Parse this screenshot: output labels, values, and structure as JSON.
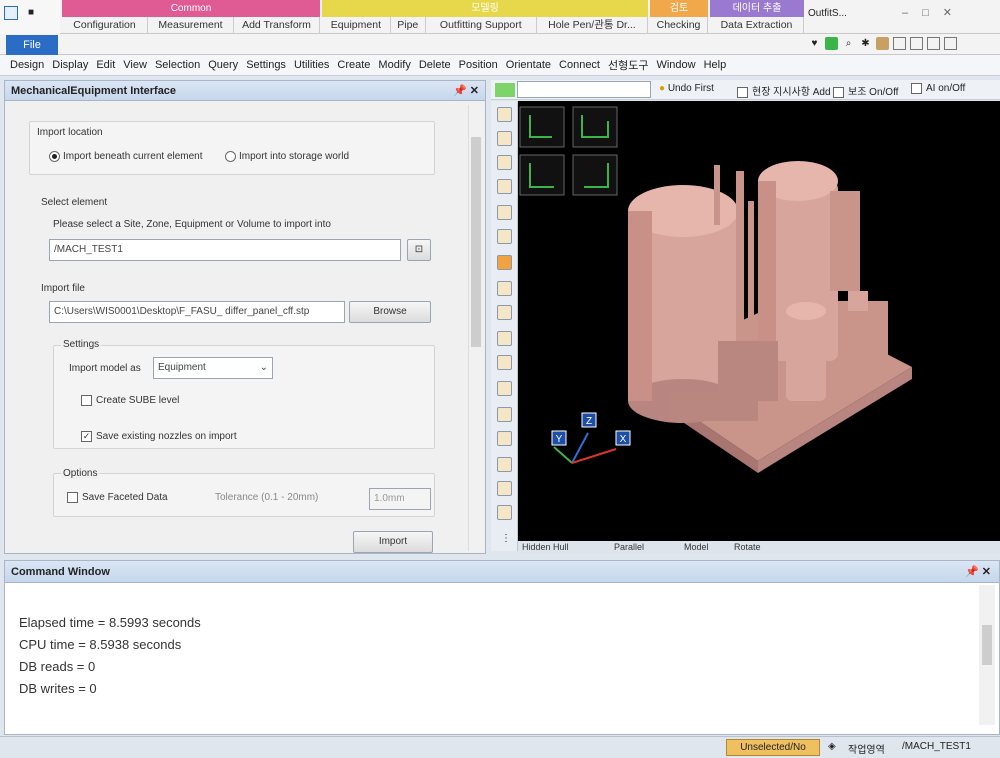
{
  "ribbon": {
    "groups": [
      {
        "title": "Common",
        "color": "#e05a94",
        "tabs": [
          "Configuration",
          "Measurement",
          "Add Transform"
        ]
      },
      {
        "title": "모델링",
        "color": "#e6d84a",
        "tabs": [
          "Equipment",
          "Pipe",
          "Outfitting Support",
          "Hole Pen/관통 Dr..."
        ]
      },
      {
        "title": "검토",
        "color": "#f0a84a",
        "tabs": [
          "Checking"
        ]
      },
      {
        "title": "데이터 추출",
        "color": "#9a7ad0",
        "tabs": [
          "Data Extraction"
        ]
      }
    ],
    "extra_tab": "OutfitS...",
    "file_tab": "File"
  },
  "menu": [
    "Design",
    "Display",
    "Edit",
    "View",
    "Selection",
    "Query",
    "Settings",
    "Utilities",
    "Create",
    "Modify",
    "Delete",
    "Position",
    "Orientate",
    "Connect",
    "선형도구",
    "Window",
    "Help"
  ],
  "left_panel": {
    "title": "MechanicalEquipment Interface",
    "import_location_label": "Import location",
    "radio_beneath": "Import beneath current element",
    "radio_storage": "Import into storage world",
    "select_element_label": "Select element",
    "select_element_hint": "Please select a Site, Zone, Equipment or Volume to import into",
    "element_value": "/MACH_TEST1",
    "import_file_label": "Import file",
    "file_path": "C:\\Users\\WIS0001\\Desktop\\F_FASU_ differ_panel_cff.stp",
    "browse_label": "Browse",
    "settings_label": "Settings",
    "import_model_as_label": "Import model as",
    "import_model_as_value": "Equipment",
    "create_subee_label": "Create SUBE level",
    "save_nozzles_label": "Save existing nozzles on import",
    "options_label": "Options",
    "save_faceted_label": "Save Faceted Data",
    "tolerance_label": "Tolerance (0.1 - 20mm)",
    "tolerance_value": "1.0mm",
    "import_button": "Import"
  },
  "view": {
    "undo_first": "Undo First",
    "check1": "현장 지시사항 Add",
    "check2": "보조 On/Off",
    "check3": "AI on/Off",
    "status": [
      "Hidden Hull",
      "Parallel",
      "Model",
      "Rotate"
    ],
    "axes": [
      "Y",
      "Z",
      "X"
    ]
  },
  "command": {
    "title": "Command Window",
    "lines": [
      "Elapsed time  = 8.5993 seconds",
      "CPU time       = 8.5938 seconds",
      "DB reads       = 0",
      "DB writes      = 0"
    ]
  },
  "statusbar": {
    "left": "Unselected/No",
    "right_label": "작업영역",
    "right_value": "/MACH_TEST1"
  }
}
